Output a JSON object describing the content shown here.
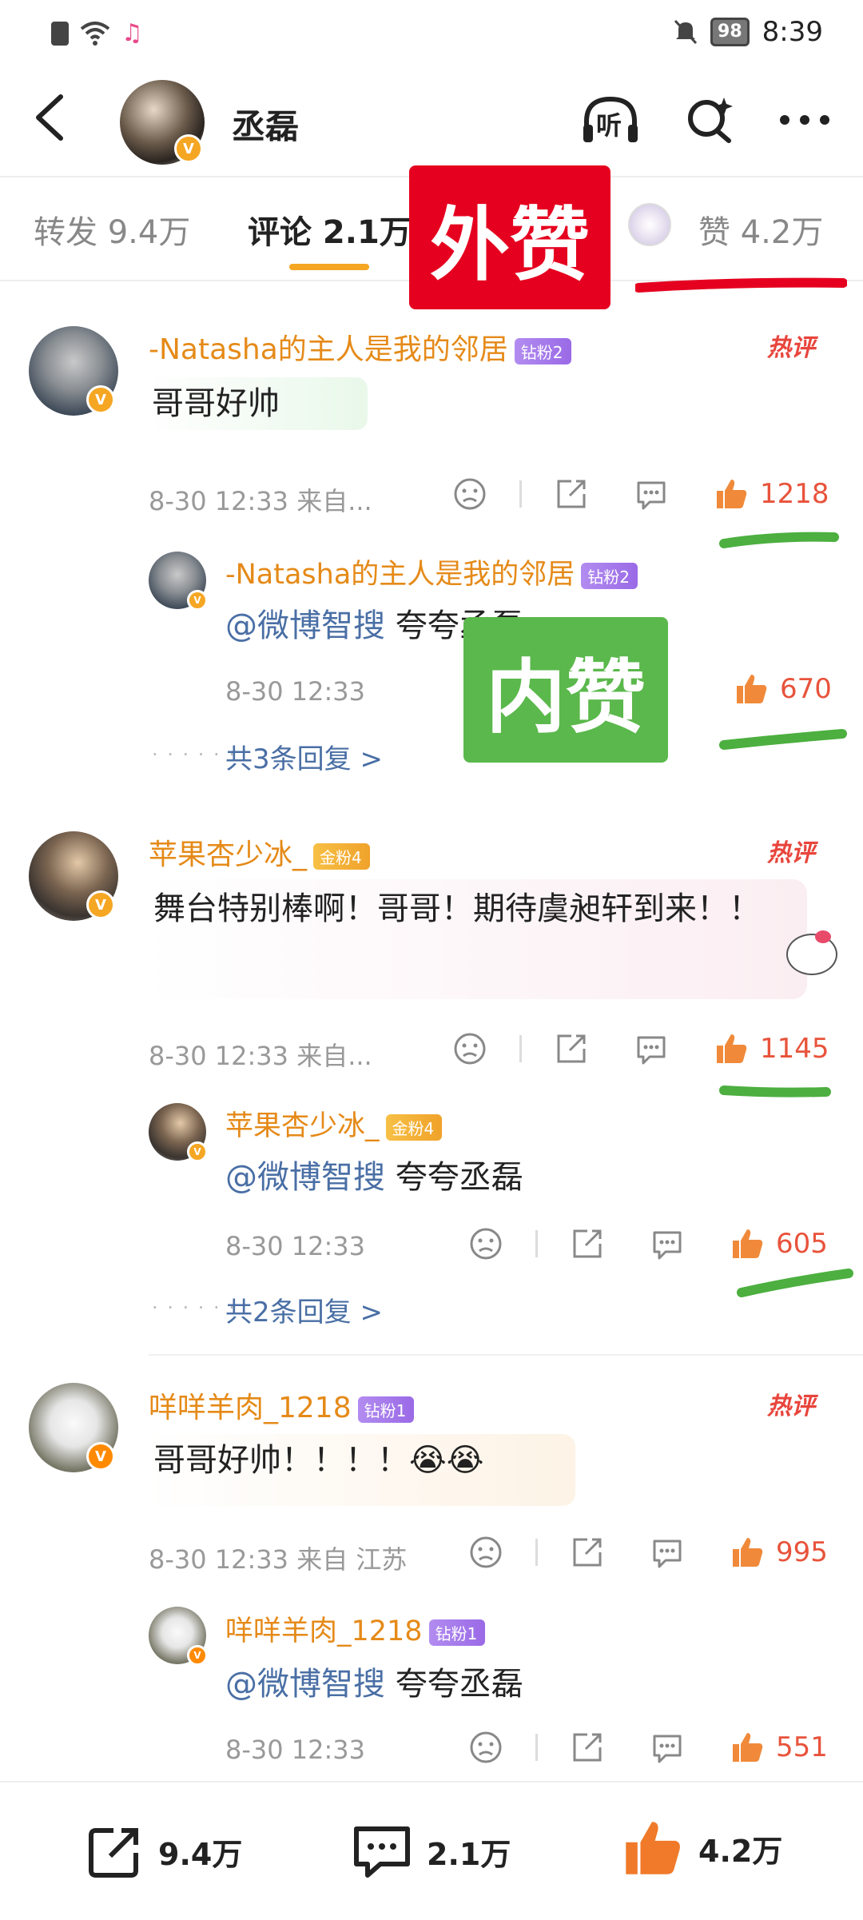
{
  "status_bar": {
    "time": "8:39",
    "battery": "98"
  },
  "header": {
    "username": "丞磊",
    "verified_mark": "V",
    "listen_label": "听"
  },
  "tabs": [
    {
      "label": "转发 9.4万"
    },
    {
      "label": "评论 2.1万"
    },
    {
      "label": "赞 4.2万"
    }
  ],
  "annotations": {
    "outer_like": "外赞",
    "inner_like": "内赞"
  },
  "comments": [
    {
      "username": "-Natasha的主人是我的邻居",
      "badge": "钻粉2",
      "hot": "热评",
      "text": "哥哥好帅",
      "time": "8-30 12:33  来自...",
      "likes": "1218",
      "reply": {
        "username": "-Natasha的主人是我的邻居",
        "badge": "钻粉2",
        "mention": "@微博智搜",
        "text": " 夸夸丞磊",
        "time": "8-30 12:33",
        "likes": "670"
      },
      "more_replies": "共3条回复 >"
    },
    {
      "username": "苹果杏少冰_",
      "badge": "金粉4",
      "hot": "热评",
      "text": "舞台特别棒啊！哥哥！期待虞昶轩到来！！",
      "time": "8-30 12:33  来自...",
      "likes": "1145",
      "reply": {
        "username": "苹果杏少冰_",
        "badge": "金粉4",
        "mention": "@微博智搜",
        "text": " 夸夸丞磊",
        "time": "8-30 12:33",
        "likes": "605"
      },
      "more_replies": "共2条回复 >"
    },
    {
      "username": "咩咩羊肉_1218",
      "badge": "钻粉1",
      "hot": "热评",
      "text": "哥哥好帅！！！！😭😭",
      "time": "8-30 12:33  来自 江苏",
      "likes": "995",
      "reply": {
        "username": "咩咩羊肉_1218",
        "badge": "钻粉1",
        "mention": "@微博智搜",
        "text": " 夸夸丞磊",
        "time": "8-30 12:33",
        "likes": "551"
      }
    }
  ],
  "bottom_bar": {
    "reposts": "9.4万",
    "comments": "2.1万",
    "likes": "4.2万"
  },
  "colors": {
    "accent": "#f5a623",
    "username": "#e58a18",
    "like": "#e8533b",
    "mention": "#4a6fa5",
    "outer_label": "#e5001f",
    "inner_label": "#5bb84c"
  }
}
